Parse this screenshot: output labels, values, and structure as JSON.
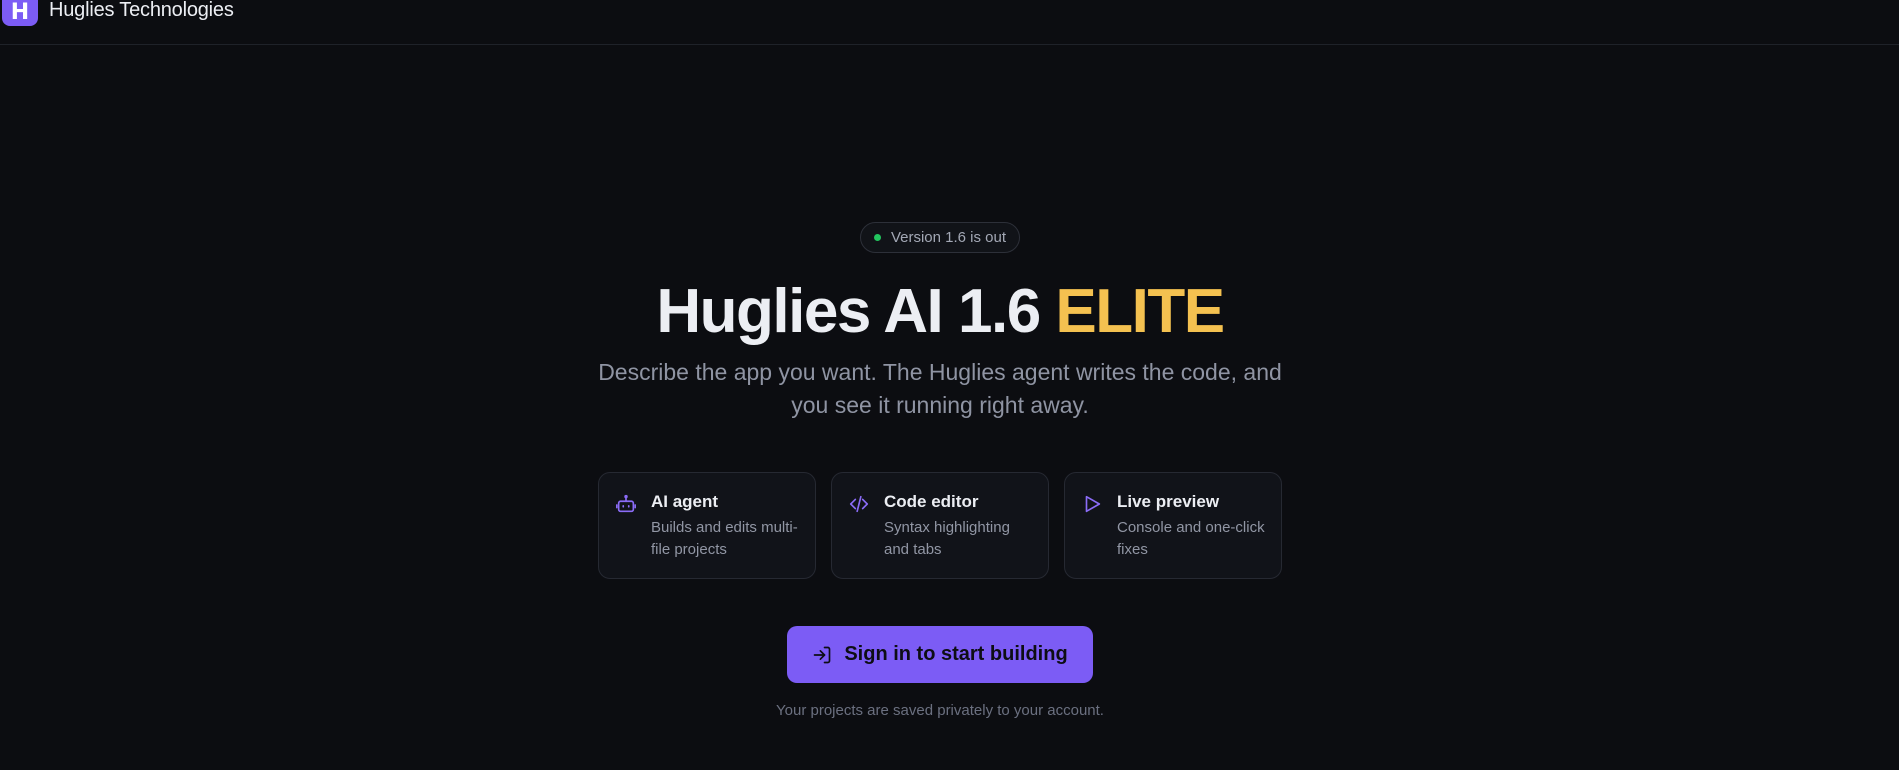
{
  "header": {
    "logo_letter": "H",
    "brand": "Huglies Technologies"
  },
  "badge": {
    "text": "Version 1.6 is out",
    "dot_color": "#22c55e"
  },
  "hero": {
    "title_main": "Huglies AI 1.6 ",
    "title_accent": "ELITE",
    "accent_color": "#f4c150",
    "subtitle": "Describe the app you want. The Huglies agent writes the code, and you see it running right away."
  },
  "features": [
    {
      "icon": "robot-icon",
      "title": "AI agent",
      "desc": "Builds and edits multi-file projects"
    },
    {
      "icon": "code-icon",
      "title": "Code editor",
      "desc": "Syntax highlighting and tabs"
    },
    {
      "icon": "play-icon",
      "title": "Live preview",
      "desc": "Console and one-click fixes"
    }
  ],
  "cta": {
    "label": "Sign in to start building",
    "icon": "sign-in-icon",
    "color": "#7c5cf5"
  },
  "footnote": "Your projects are saved privately to your account."
}
